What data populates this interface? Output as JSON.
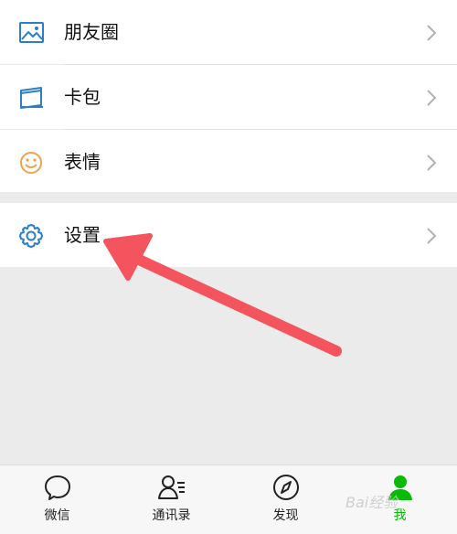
{
  "menu": {
    "items": [
      {
        "label": "朋友圈",
        "icon": "moments-icon"
      },
      {
        "label": "卡包",
        "icon": "card-wallet-icon"
      },
      {
        "label": "表情",
        "icon": "emoji-icon"
      },
      {
        "label": "设置",
        "icon": "gear-icon"
      }
    ]
  },
  "tabbar": {
    "tabs": [
      {
        "label": "微信",
        "icon": "chat-bubble-icon",
        "active": false
      },
      {
        "label": "通讯录",
        "icon": "contacts-icon",
        "active": false
      },
      {
        "label": "发现",
        "icon": "compass-icon",
        "active": false
      },
      {
        "label": "我",
        "icon": "person-icon",
        "active": true
      }
    ]
  },
  "colors": {
    "accent_green": "#09bb07",
    "icon_blue": "#2b7ec9",
    "emoji_orange": "#f0a24a",
    "arrow_red": "#f4545e",
    "background_gray": "#ebebeb"
  },
  "watermark": {
    "text": "Bai经验"
  }
}
